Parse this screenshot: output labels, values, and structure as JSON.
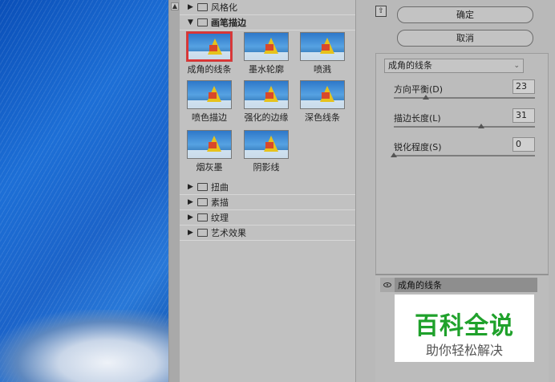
{
  "preview": {
    "colors": {
      "sky": "#1d6fd6",
      "snow": "#eef2f8"
    }
  },
  "gallery": {
    "categories": [
      {
        "label": "风格化",
        "expanded": false
      },
      {
        "label": "画笔描边",
        "expanded": true
      },
      {
        "label": "扭曲",
        "expanded": false
      },
      {
        "label": "素描",
        "expanded": false
      },
      {
        "label": "纹理",
        "expanded": false
      },
      {
        "label": "艺术效果",
        "expanded": false
      }
    ],
    "brush_filters": [
      {
        "label": "成角的线条",
        "selected": true
      },
      {
        "label": "墨水轮廓",
        "selected": false
      },
      {
        "label": "喷溅",
        "selected": false
      },
      {
        "label": "喷色描边",
        "selected": false
      },
      {
        "label": "强化的边缘",
        "selected": false
      },
      {
        "label": "深色线条",
        "selected": false
      },
      {
        "label": "烟灰墨",
        "selected": false
      },
      {
        "label": "阴影线",
        "selected": false
      }
    ]
  },
  "buttons": {
    "ok": "确定",
    "cancel": "取消"
  },
  "settings": {
    "filter_select": "成角的线条",
    "params": [
      {
        "label": "方向平衡(D)",
        "value": "23",
        "level_pct": 23
      },
      {
        "label": "描边长度(L)",
        "value": "31",
        "level_pct": 62
      },
      {
        "label": "锐化程度(S)",
        "value": "0",
        "level_pct": 0
      }
    ]
  },
  "layers": {
    "layer_name": "成角的线条"
  },
  "watermark": {
    "main": "百科全说",
    "sub": "助你轻松解决"
  },
  "accent_colors": {
    "selection": "#d33333",
    "watermark_green": "#1fa12b"
  }
}
